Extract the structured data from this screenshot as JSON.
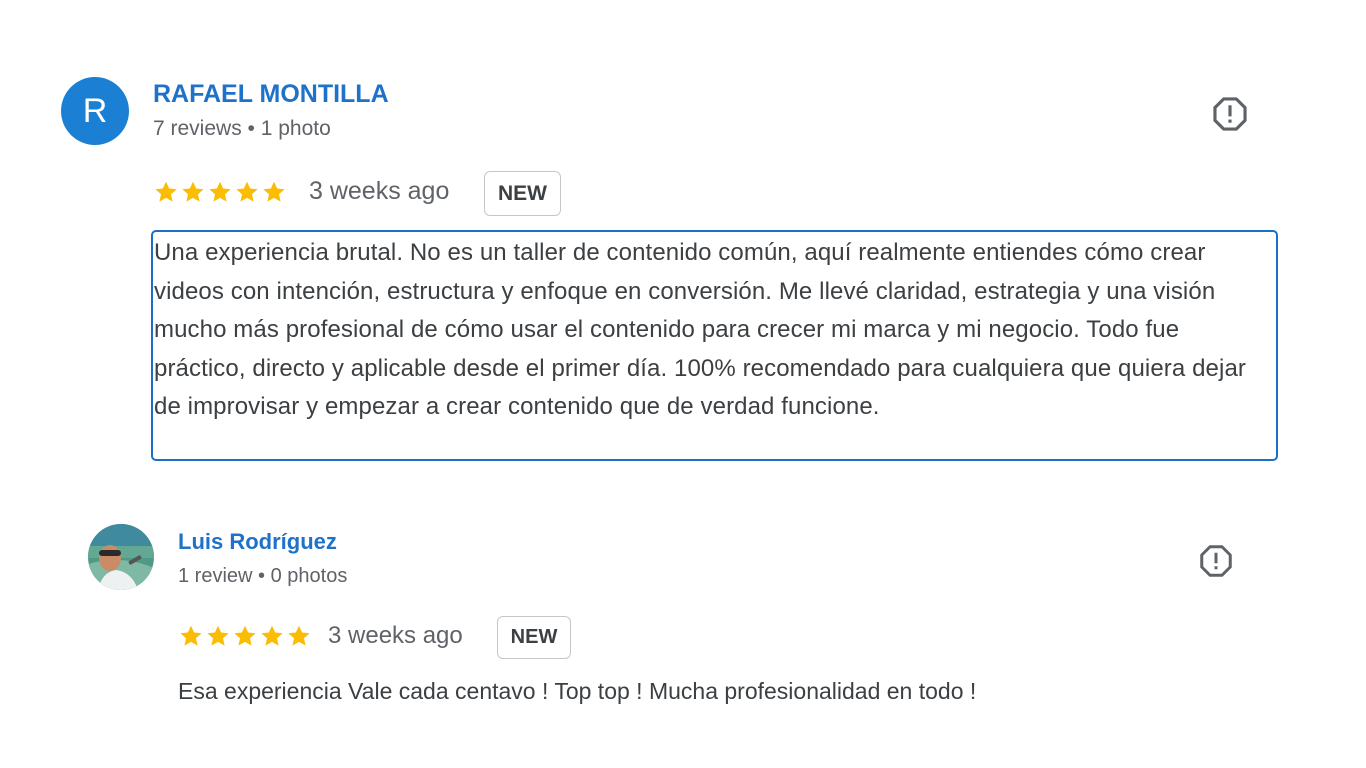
{
  "reviews": [
    {
      "author": "RAFAEL MONTILLA",
      "avatar_letter": "R",
      "meta": "7 reviews • 1 photo",
      "rating": 5,
      "time": "3 weeks ago",
      "badge": "NEW",
      "text": "Una experiencia brutal. No es un taller de contenido común, aquí realmente entiendes cómo crear videos con intención, estructura y enfoque en conversión. Me llevé claridad, estrategia y una visión mucho más profesional de cómo usar el contenido para crecer mi marca y mi negocio. Todo fue práctico, directo y aplicable desde el primer día. 100% recomendado para cualquiera que quiera dejar de improvisar y empezar a crear contenido que de verdad funcione."
    },
    {
      "author": "Luis Rodríguez",
      "meta": "1 review • 0 photos",
      "rating": 5,
      "time": "3 weeks ago",
      "badge": "NEW",
      "text": "Esa experiencia Vale cada centavo ! Top top ! Mucha profesionalidad en todo !"
    }
  ],
  "colors": {
    "author_link": "#1f72c9",
    "avatar_bg": "#1b80d4",
    "star": "#fbbc04",
    "focus_border": "#1b6fc4"
  },
  "icons": {
    "flag": "report-flag-icon",
    "star": "star-icon"
  }
}
